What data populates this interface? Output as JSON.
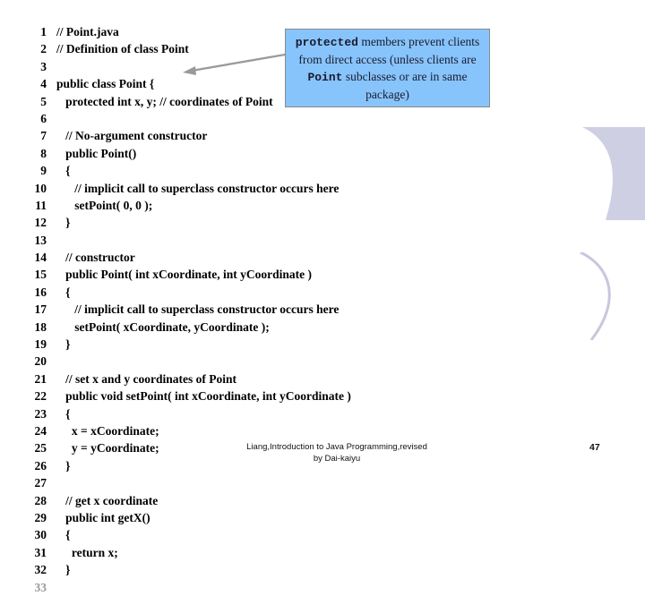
{
  "slide": {
    "page_number": "47",
    "footer_line_1": "Liang,Introduction to Java Programming,revised",
    "footer_line_2": "by Dai-kaiyu"
  },
  "code": {
    "language": "java",
    "lines": [
      {
        "no": "1",
        "src": "// Point.java"
      },
      {
        "no": "2",
        "src": "// Definition of class Point"
      },
      {
        "no": "3",
        "src": ""
      },
      {
        "no": "4",
        "src": "public class Point {"
      },
      {
        "no": "5",
        "src": "   protected int x, y; // coordinates of Point"
      },
      {
        "no": "6",
        "src": ""
      },
      {
        "no": "7",
        "src": "   // No-argument constructor"
      },
      {
        "no": "8",
        "src": "   public Point()"
      },
      {
        "no": "9",
        "src": "   {"
      },
      {
        "no": "10",
        "src": "      // implicit call to superclass constructor occurs here"
      },
      {
        "no": "11",
        "src": "      setPoint( 0, 0 );"
      },
      {
        "no": "12",
        "src": "   }"
      },
      {
        "no": "13",
        "src": ""
      },
      {
        "no": "14",
        "src": "   // constructor"
      },
      {
        "no": "15",
        "src": "   public Point( int xCoordinate, int yCoordinate )"
      },
      {
        "no": "16",
        "src": "   {"
      },
      {
        "no": "17",
        "src": "      // implicit call to superclass constructor occurs here"
      },
      {
        "no": "18",
        "src": "      setPoint( xCoordinate, yCoordinate );"
      },
      {
        "no": "19",
        "src": "   }"
      },
      {
        "no": "20",
        "src": ""
      },
      {
        "no": "21",
        "src": "   // set x and y coordinates of Point"
      },
      {
        "no": "22",
        "src": "   public void setPoint( int xCoordinate, int yCoordinate )"
      },
      {
        "no": "23",
        "src": "   {"
      },
      {
        "no": "24",
        "src": "     x = xCoordinate;"
      },
      {
        "no": "25",
        "src": "     y = yCoordinate;"
      },
      {
        "no": "26",
        "src": "   }"
      },
      {
        "no": "27",
        "src": ""
      },
      {
        "no": "28",
        "src": "   // get x coordinate"
      },
      {
        "no": "29",
        "src": "   public int getX()"
      },
      {
        "no": "30",
        "src": "   {"
      },
      {
        "no": "31",
        "src": "     return x;"
      },
      {
        "no": "32",
        "src": "   }"
      },
      {
        "no": "33",
        "src": "",
        "faded": true
      }
    ]
  },
  "callout": {
    "segments": [
      {
        "text": "protected",
        "style": "mono"
      },
      {
        "text": " members prevent clients from direct access (unless clients are ",
        "style": "normal"
      },
      {
        "text": "Point",
        "style": "mono"
      },
      {
        "text": " subclasses or are in same package)",
        "style": "normal"
      }
    ],
    "plain_text": "protected members prevent clients from direct access (unless clients are Point subclasses or are in same package)",
    "fill_color": "#87c4fb",
    "border_color": "#8a8a8a",
    "arrow_color": "#9a9a9a",
    "points_at_line": "4"
  },
  "decorations": {
    "arc_color": "#cfcfe3",
    "arc_outline_color": "#c7c7dd"
  }
}
